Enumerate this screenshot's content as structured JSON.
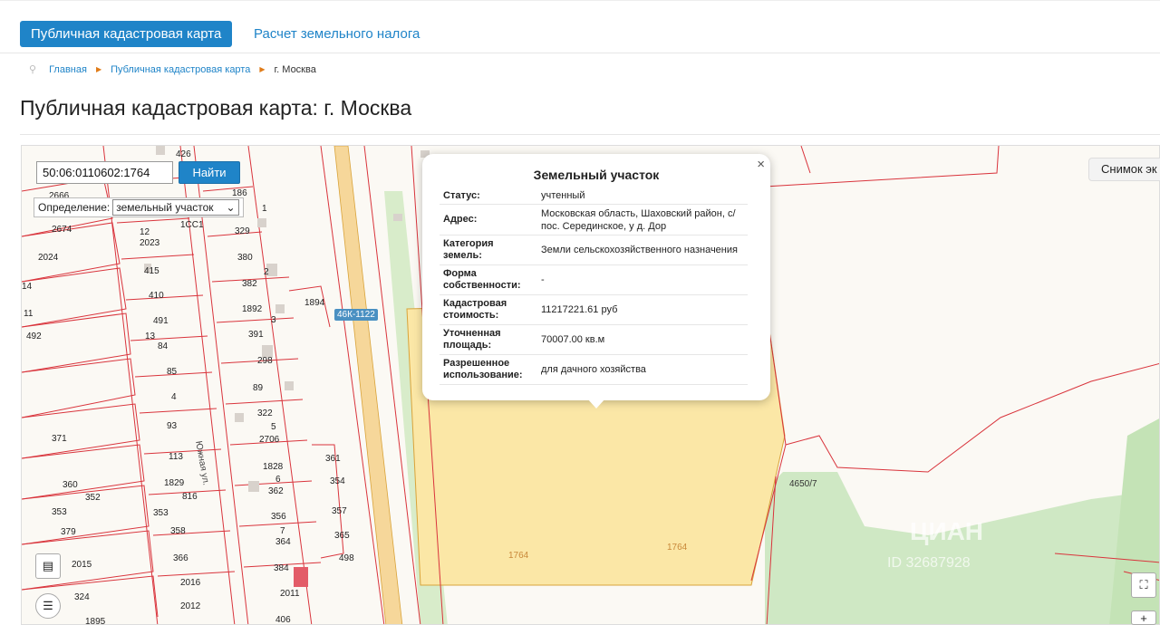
{
  "nav": {
    "active_tab": "Публичная кадастровая карта",
    "tab_tax": "Расчет земельного налога"
  },
  "breadcrumb": {
    "home": "Главная",
    "map": "Публичная кадастровая карта",
    "current": "г. Москва"
  },
  "page_title": "Публичная кадастровая карта: г. Москва",
  "map": {
    "search_value": "50:06:0110602:1764",
    "search_button": "Найти",
    "definition_label": "Определение:",
    "definition_value": "земельный участок",
    "snapshot_button": "Снимок эк",
    "road_label": "46К-1122",
    "street_label": "Южная ул.",
    "parcel_label_left": "1764",
    "parcel_label_right": "1764",
    "neighbor_label": "4650/7",
    "watermark": "ЦИАН",
    "watermark_id": "ID 32687928",
    "lot_numbers": [
      "426",
      "2666",
      "186",
      "2674",
      "2023",
      "329",
      "2024",
      "415",
      "380",
      "410",
      "382",
      "14",
      "491",
      "1892",
      "11",
      "84",
      "391",
      "492",
      "85",
      "298",
      "4",
      "89",
      "322",
      "93",
      "371",
      "2706",
      "113",
      "1828",
      "360",
      "1829",
      "362",
      "352",
      "816",
      "353",
      "353",
      "356",
      "379",
      "358",
      "364",
      "366",
      "2015",
      "384",
      "2016",
      "2011",
      "324",
      "2012",
      "406",
      "1895",
      "361",
      "354",
      "357",
      "365",
      "498",
      "1894",
      "12",
      "13",
      "1",
      "2",
      "3",
      "5",
      "6",
      "7",
      "1СС1"
    ]
  },
  "popup": {
    "title": "Земельный участок",
    "close": "×",
    "rows": [
      {
        "key": "Статус:",
        "value": "учтенный"
      },
      {
        "key": "Адрес:",
        "value": "Московская область, Шаховский район, с/пос. Серединское, у д. Дор"
      },
      {
        "key": "Категория земель:",
        "value": "Земли сельскохозяйственного назначения"
      },
      {
        "key": "Форма собственности:",
        "value": "-"
      },
      {
        "key": "Кадастровая стоимость:",
        "value": "11217221.61 руб"
      },
      {
        "key": "Уточненная площадь:",
        "value": "70007.00 кв.м"
      },
      {
        "key": "Разрешенное использование:",
        "value": "для дачного хозяйства"
      }
    ]
  },
  "colors": {
    "accent": "#1f84c8",
    "parcel_fill": "#fbe7a6",
    "parcel_border": "#d9a33a",
    "boundary": "#d9343c",
    "green": "#cfe8c4"
  }
}
